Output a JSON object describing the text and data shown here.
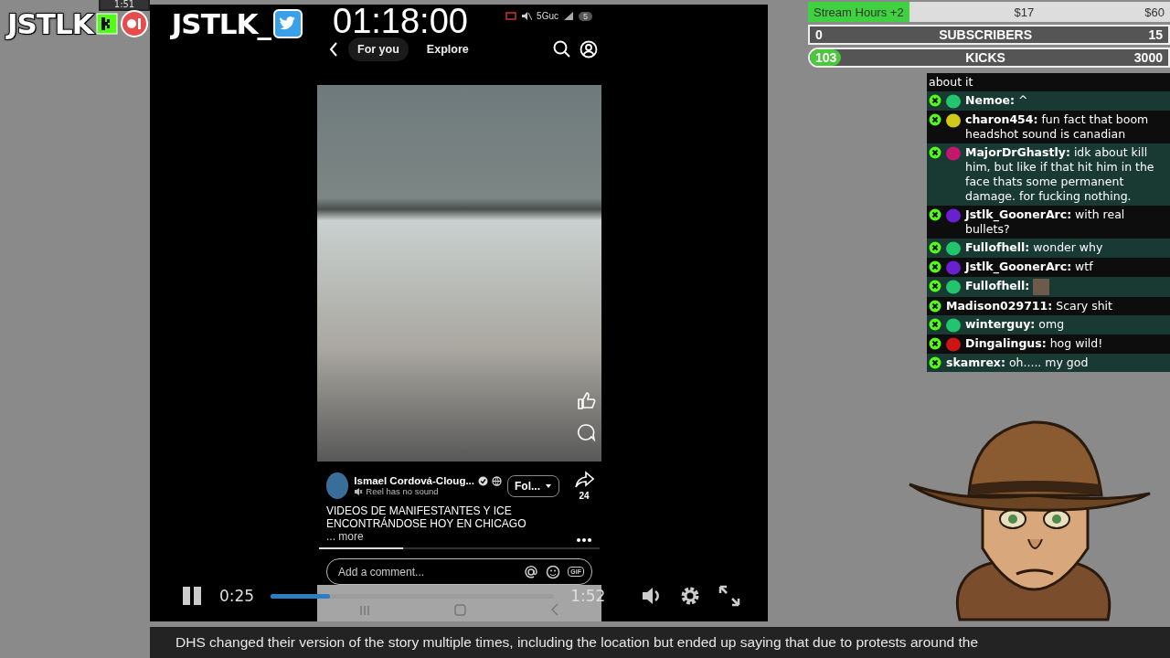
{
  "overlay": {
    "clock": "1:51",
    "logos": [
      {
        "text": "JSTLK",
        "kind": "kick"
      },
      {
        "text": "JSTLK_",
        "kind": "twitter"
      }
    ],
    "timer": "01:18:00"
  },
  "goals": [
    {
      "kind": "money",
      "label": "Stream Hours +2",
      "middle": "$17",
      "end": "$60",
      "level": 0.28
    },
    {
      "kind": "count",
      "start": "0",
      "label": "SUBSCRIBERS",
      "end": "15",
      "level": 0
    },
    {
      "kind": "round",
      "start": "103",
      "label": "KICKS",
      "end": "3000",
      "level": 0.034
    }
  ],
  "chat": [
    {
      "kind": "continuation",
      "text": "about it"
    },
    {
      "kind": "text",
      "name": "Nemoe:",
      "text": "^",
      "color": "#22c46e"
    },
    {
      "kind": "text",
      "name": "charon454:",
      "text": "fun fact that boom headshot sound is canadian",
      "color": "#d2c81c"
    },
    {
      "kind": "text",
      "name": "MajorDrGhastly:",
      "text": "idk about kill him, but like if that hit him in the face thats some permanent damage. for fucking nothing.",
      "color": "#c4166e"
    },
    {
      "kind": "text",
      "name": "Jstlk_GoonerArc:",
      "text": "with real bullets?",
      "color": "#6a1fd0"
    },
    {
      "kind": "text",
      "name": "Fullofhell:",
      "text": "wonder why",
      "color": "#22c46e"
    },
    {
      "kind": "text",
      "name": "Jstlk_GoonerArc:",
      "text": "wtf",
      "color": "#6a1fd0"
    },
    {
      "kind": "emote",
      "name": "Fullofhell:",
      "color": "#22c46e"
    },
    {
      "kind": "text",
      "name": "Madison029711:",
      "text": "Scary shit"
    },
    {
      "kind": "text",
      "name": "winterguy:",
      "text": "omg",
      "color": "#22c46e"
    },
    {
      "kind": "text",
      "name": "Dingalingus:",
      "text": "hog wild!",
      "color": "#cc1414"
    },
    {
      "kind": "text",
      "name": "skamrex:",
      "text": "oh..... my god"
    }
  ],
  "phone": {
    "network": "5Guc",
    "battery": "5",
    "tabs": [
      {
        "label": "For you",
        "selected": true
      },
      {
        "label": "Explore",
        "selected": false
      }
    ],
    "author": "Ismael Cordová-Cloug...",
    "sound_note": "Reel has no sound",
    "follow": "Fol...",
    "share_count": "24",
    "caption": "VIDEOS DE MANIFESTANTES Y ICE ENCONTRÁNDOSE HOY EN CHICAGO",
    "more": "... more",
    "reel_progress": {
      "level": 0.3
    },
    "comment_placeholder": "Add a comment...",
    "gif": "GIF"
  },
  "player": {
    "playing": true,
    "elapsed": "0:25",
    "duration": "1:52",
    "progress": {
      "level": 0.21
    }
  },
  "caption_bar": {
    "text": "DHS changed their version of the story multiple times, including the location but ended up saying that due to protests around the"
  }
}
